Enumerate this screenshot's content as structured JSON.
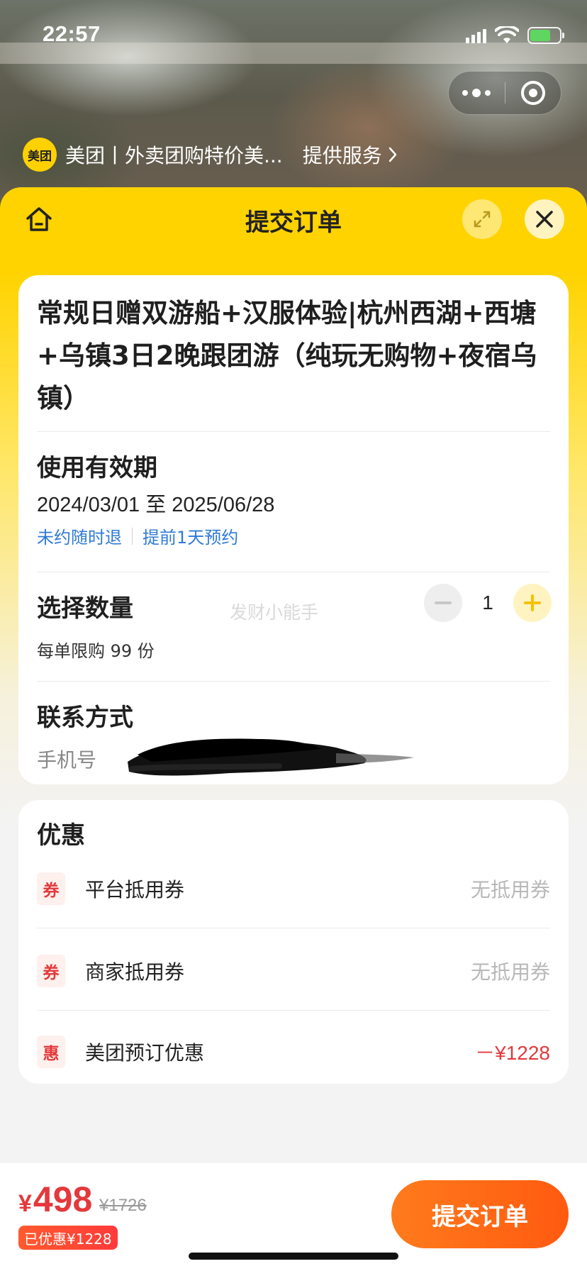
{
  "status_bar": {
    "time": "22:57"
  },
  "service_bar": {
    "logo_text": "美团",
    "name": "美团丨外卖团购特价美...",
    "link_label": "提供服务"
  },
  "sheet": {
    "title": "提交订单",
    "icons": {
      "home": "home-icon",
      "expand": "expand-icon",
      "close": "close-icon"
    }
  },
  "product": {
    "title": "常规日赠双游船+汉服体验|杭州西湖+西塘+乌镇3日2晚跟团游（纯玩无购物+夜宿乌镇）"
  },
  "validity": {
    "label": "使用有效期",
    "dates": "2024/03/01 至 2025/06/28",
    "tags": [
      "未约随时退",
      "提前1天预约"
    ]
  },
  "quantity": {
    "label": "选择数量",
    "value": "1",
    "limit": "每单限购 99 份",
    "watermark": "发财小能手"
  },
  "contact": {
    "label": "联系方式",
    "phone_label": "手机号"
  },
  "discounts": {
    "title": "优惠",
    "rows": [
      {
        "tag": "券",
        "name": "平台抵用券",
        "value": "无抵用券"
      },
      {
        "tag": "券",
        "name": "商家抵用券",
        "value": "无抵用券"
      },
      {
        "tag": "惠",
        "name": "美团预订优惠",
        "value": "－¥1228"
      }
    ]
  },
  "footer": {
    "price_symbol": "¥",
    "price": "498",
    "original_price": "¥1726",
    "saved": "已优惠¥1228",
    "submit_label": "提交订单"
  },
  "colors": {
    "brand_yellow": "#ffd300",
    "price_red": "#e4393c",
    "submit_orange": "#ff6a14",
    "link_blue": "#2f7ad6"
  }
}
